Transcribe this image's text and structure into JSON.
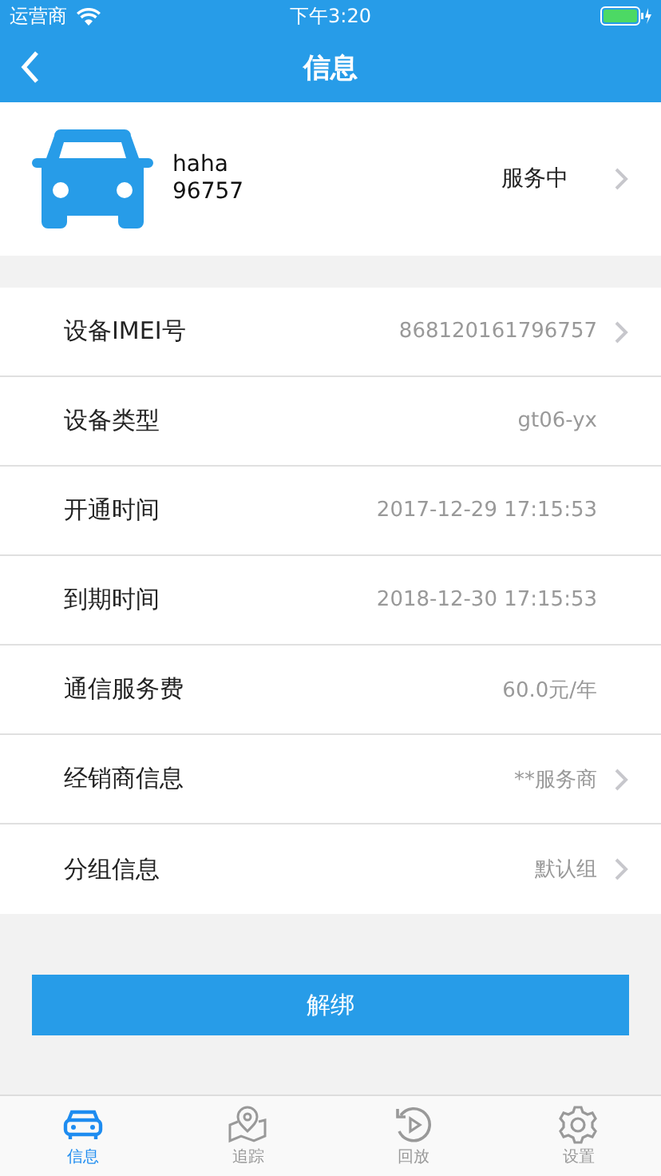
{
  "status_bar": {
    "carrier": "运营商",
    "time": "下午3:20"
  },
  "nav": {
    "title": "信息"
  },
  "device": {
    "name": "haha",
    "number": "96757",
    "status": "服务中"
  },
  "rows": [
    {
      "label": "设备IMEI号",
      "value": "868120161796757",
      "arrow": true
    },
    {
      "label": "设备类型",
      "value": "gt06-yx",
      "arrow": false
    },
    {
      "label": "开通时间",
      "value": "2017-12-29 17:15:53",
      "arrow": false
    },
    {
      "label": "到期时间",
      "value": "2018-12-30 17:15:53",
      "arrow": false
    },
    {
      "label": "通信服务费",
      "value": "60.0元/年",
      "arrow": false
    },
    {
      "label": "经销商信息",
      "value": "**服务商",
      "arrow": true
    },
    {
      "label": "分组信息",
      "value": "默认组",
      "arrow": true
    }
  ],
  "unbind_button": "解绑",
  "tabs": [
    {
      "label": "信息",
      "kind": "car",
      "selected": true
    },
    {
      "label": "追踪",
      "kind": "map",
      "selected": false
    },
    {
      "label": "回放",
      "kind": "replay",
      "selected": false
    },
    {
      "label": "设置",
      "kind": "gear",
      "selected": false
    }
  ]
}
